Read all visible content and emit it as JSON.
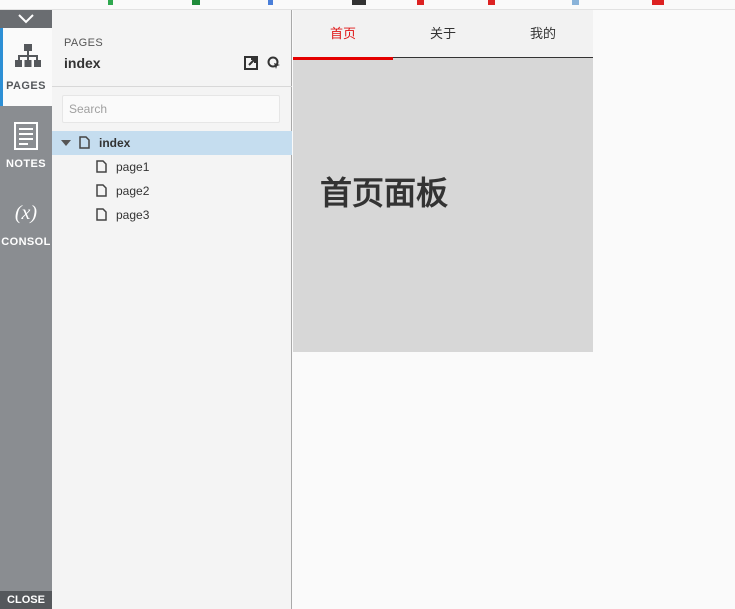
{
  "rail": {
    "tabs": [
      {
        "label": "PAGES",
        "icon": "sitemap-icon"
      },
      {
        "label": "NOTES",
        "icon": "notes-icon"
      },
      {
        "label": "CONSOL",
        "icon": "variable-x-icon"
      }
    ],
    "close_label": "CLOSE"
  },
  "pages_panel": {
    "header_label": "PAGES",
    "current_page": "index",
    "search_placeholder": "Search",
    "tree": {
      "root": "index",
      "children": [
        "page1",
        "page2",
        "page3"
      ]
    }
  },
  "canvas": {
    "tabs": [
      "首页",
      "关于",
      "我的"
    ],
    "active_tab": "首页",
    "panel_title": "首页面板"
  },
  "colors": {
    "accent_red": "#e40000",
    "selected_row": "#c5ddef",
    "rail_bg": "#8a8d91",
    "active_tab_border": "#2d8fd5"
  }
}
